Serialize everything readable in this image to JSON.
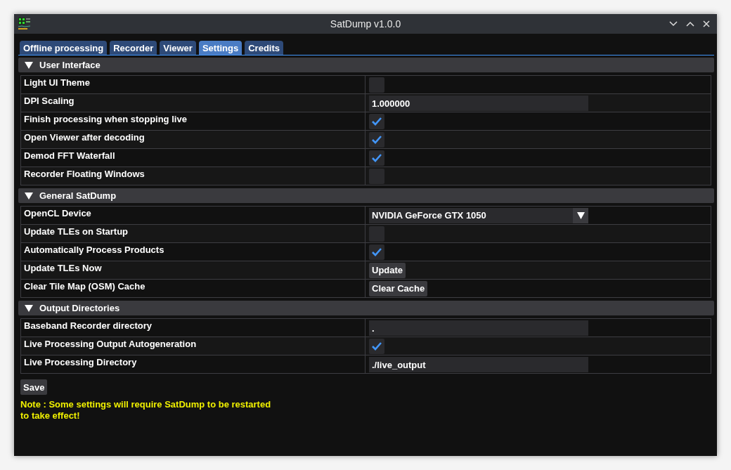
{
  "window": {
    "title": "SatDump v1.0.0"
  },
  "tabs": [
    {
      "label": "Offline processing",
      "selected": false
    },
    {
      "label": "Recorder",
      "selected": false
    },
    {
      "label": "Viewer",
      "selected": false
    },
    {
      "label": "Settings",
      "selected": true
    },
    {
      "label": "Credits",
      "selected": false
    }
  ],
  "sections": [
    {
      "title": "User Interface",
      "expanded": true,
      "rows": [
        {
          "label": "Light UI Theme",
          "kind": "checkbox",
          "checked": false
        },
        {
          "label": "DPI Scaling",
          "kind": "input",
          "value": "1.000000"
        },
        {
          "label": "Finish processing when stopping live",
          "kind": "checkbox",
          "checked": true
        },
        {
          "label": "Open Viewer after decoding",
          "kind": "checkbox",
          "checked": true
        },
        {
          "label": "Demod FFT Waterfall",
          "kind": "checkbox",
          "checked": true
        },
        {
          "label": "Recorder Floating Windows",
          "kind": "checkbox",
          "checked": false
        }
      ]
    },
    {
      "title": "General SatDump",
      "expanded": true,
      "rows": [
        {
          "label": "OpenCL Device",
          "kind": "dropdown",
          "value": "NVIDIA GeForce GTX 1050"
        },
        {
          "label": "Update TLEs on Startup",
          "kind": "checkbox",
          "checked": false
        },
        {
          "label": "Automatically Process Products",
          "kind": "checkbox",
          "checked": true
        },
        {
          "label": "Update TLEs Now",
          "kind": "button",
          "value": "Update"
        },
        {
          "label": "Clear Tile Map (OSM) Cache",
          "kind": "button",
          "value": "Clear Cache"
        }
      ]
    },
    {
      "title": "Output Directories",
      "expanded": true,
      "rows": [
        {
          "label": "Baseband Recorder directory",
          "kind": "input",
          "value": "."
        },
        {
          "label": "Live Processing Output Autogeneration",
          "kind": "checkbox",
          "checked": true
        },
        {
          "label": "Live Processing Directory",
          "kind": "input",
          "value": "./live_output"
        }
      ]
    }
  ],
  "save_button": "Save",
  "note": "Note : Some settings will require SatDump to be restarted to take effect!"
}
